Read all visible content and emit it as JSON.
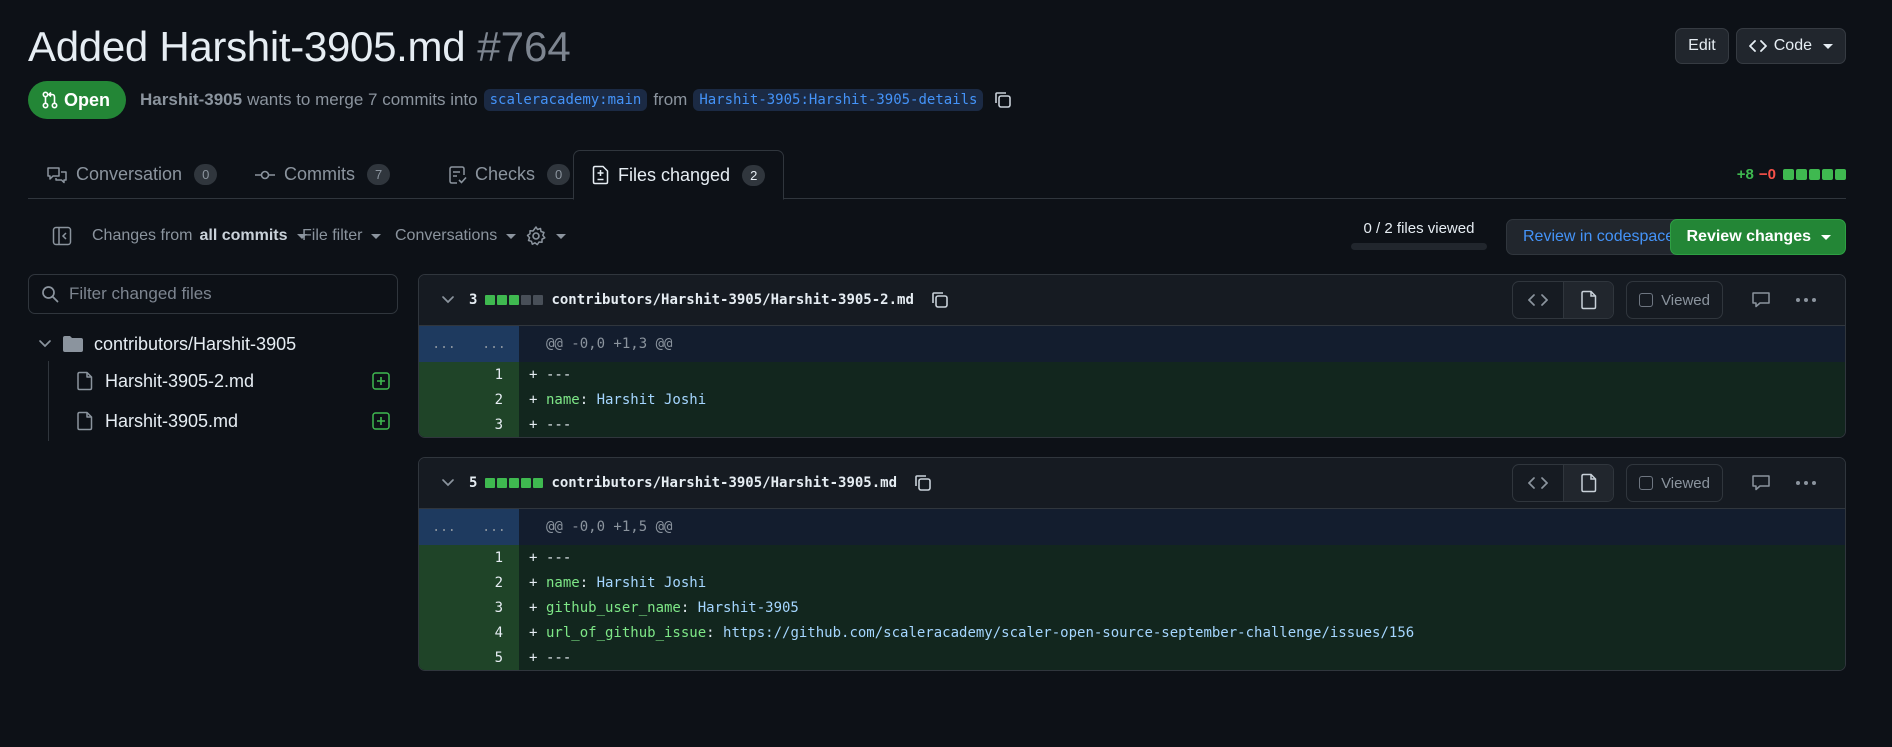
{
  "header": {
    "title": "Added Harshit-3905.md",
    "number": "#764",
    "edit_label": "Edit",
    "code_label": "Code"
  },
  "meta": {
    "state": "Open",
    "author": "Harshit-3905",
    "action_text": "wants to merge 7 commits into",
    "base_branch": "scaleracademy:main",
    "from_text": "from",
    "head_branch": "Harshit-3905:Harshit-3905-details"
  },
  "tabs": [
    {
      "label": "Conversation",
      "count": "0"
    },
    {
      "label": "Commits",
      "count": "7"
    },
    {
      "label": "Checks",
      "count": "0"
    },
    {
      "label": "Files changed",
      "count": "2"
    }
  ],
  "diffstat": {
    "additions": "+8",
    "deletions": "−0"
  },
  "toolbar": {
    "changes_from": "Changes from",
    "changes_from_value": "all commits",
    "file_filter": "File filter",
    "conversations": "Conversations",
    "files_viewed": "0 / 2 files viewed",
    "review_codespace": "Review in codespace",
    "review_changes": "Review changes"
  },
  "sidebar": {
    "filter_placeholder": "Filter changed files",
    "directory": "contributors/Harshit-3905",
    "files": [
      "Harshit-3905-2.md",
      "Harshit-3905.md"
    ]
  },
  "files": [
    {
      "count": "3",
      "path": "contributors/Harshit-3905/Harshit-3905-2.md",
      "viewed_label": "Viewed",
      "hunk_gutter": [
        "...",
        "..."
      ],
      "hunk": "@@ -0,0 +1,3 @@",
      "lines": [
        {
          "n": "1",
          "plus": "+",
          "key": "",
          "punc": "",
          "val": "---"
        },
        {
          "n": "2",
          "plus": "+",
          "key": "name",
          "punc": ": ",
          "val": "Harshit Joshi"
        },
        {
          "n": "3",
          "plus": "+",
          "key": "",
          "punc": "",
          "val": "---"
        }
      ]
    },
    {
      "count": "5",
      "path": "contributors/Harshit-3905/Harshit-3905.md",
      "viewed_label": "Viewed",
      "hunk_gutter": [
        "...",
        "..."
      ],
      "hunk": "@@ -0,0 +1,5 @@",
      "lines": [
        {
          "n": "1",
          "plus": "+",
          "key": "",
          "punc": "",
          "val": "---"
        },
        {
          "n": "2",
          "plus": "+",
          "key": "name",
          "punc": ": ",
          "val": "Harshit Joshi"
        },
        {
          "n": "3",
          "plus": "+",
          "key": "github_user_name",
          "punc": ": ",
          "val": "Harshit-3905"
        },
        {
          "n": "4",
          "plus": "+",
          "key": "url_of_github_issue",
          "punc": ": ",
          "val": "https://github.com/scaleracademy/scaler-open-source-september-challenge/issues/156"
        },
        {
          "n": "5",
          "plus": "+",
          "key": "",
          "punc": "",
          "val": "---"
        }
      ]
    }
  ]
}
